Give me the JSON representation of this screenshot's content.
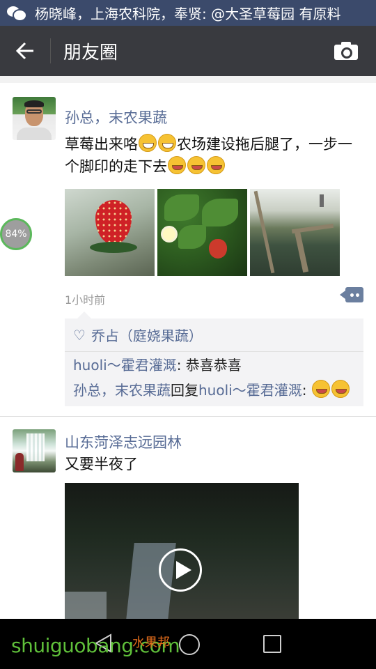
{
  "status_bar": {
    "notification": "杨晓峰，上海农科院，奉贤: @大圣草莓园 有原料"
  },
  "app_bar": {
    "title": "朋友圈",
    "back_icon": "arrow-left-icon",
    "camera_icon": "camera-icon"
  },
  "posts": [
    {
      "author": "孙总，末农果蔬",
      "text_part1": "草莓出来咯",
      "text_part2": "农场建设拖后腿了，一步一个脚印的走下去",
      "photos": [
        "strawberry",
        "strawberry-plant",
        "farm-construction"
      ],
      "time": "1小时前",
      "likes": "乔占（庭娆果蔬）",
      "comments": [
        {
          "user": "huoli～霍君灌溉",
          "text": ": 恭喜恭喜"
        },
        {
          "user": "孙总，末农果蔬",
          "reply_word": "回复",
          "reply_to": "huoli～霍君灌溉",
          "text": ": "
        }
      ]
    },
    {
      "author": "山东菏泽志远园林",
      "text": "又要半夜了",
      "media": "video"
    }
  ],
  "badge": {
    "value": "84%"
  },
  "watermark": {
    "text": "shuiguobang.com",
    "sub": "水果邦"
  },
  "colors": {
    "status_bar": "#3b4a6b",
    "app_bar": "#393a3f",
    "link": "#576b95",
    "badge_ring": "#5cb85c"
  }
}
